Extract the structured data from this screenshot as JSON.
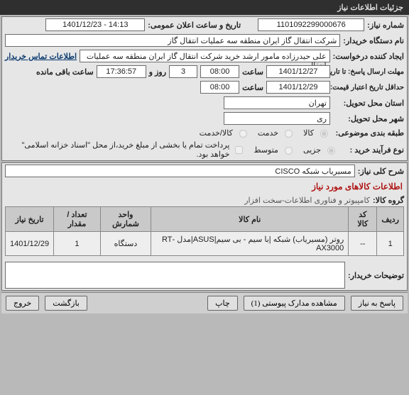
{
  "window_title": "جزئیات اطلاعات نیاز",
  "fields": {
    "need_no_label": "شماره نیاز:",
    "need_no_value": "1101092299000676",
    "announce_label": "تاریخ و ساعت اعلان عمومی:",
    "announce_value": "1401/12/23 - 14:13",
    "org_label": "نام دستگاه خریدار:",
    "org_value": "شرکت انتقال گاز ایران منطقه سه عملیات انتقال گاز",
    "creator_label": "ایجاد کننده درخواست:",
    "creator_value": "علی حیدرزاده مامور ارشد خرید شرکت انتقال گاز ایران منطقه سه عملیات انتقال",
    "contact_link": "اطلاعات تماس خریدار",
    "reply_deadline_label": "مهلت ارسال پاسخ: تا تاریخ:",
    "reply_date": "1401/12/27",
    "time_label": "ساعت",
    "reply_time": "08:00",
    "day_val": "3",
    "day_label": "روز و",
    "remaining_time": "17:36:57",
    "remaining_label": "ساعت باقی مانده",
    "price_valid_label": "حداقل تاریخ اعتبار قیمت: تا تاریخ:",
    "price_date": "1401/12/29",
    "price_time": "08:00",
    "province_label": "استان محل تحویل:",
    "province_value": "تهران",
    "city_label": "شهر محل تحویل:",
    "city_value": "ری",
    "category_label": "طبقه بندی موضوعی:",
    "cat_goods": "کالا",
    "cat_service": "خدمت",
    "cat_both": "کالا/خدمت",
    "buy_type_label": "نوع فرآیند خرید :",
    "bt_low": "جزیی",
    "bt_mid": "متوسط",
    "checkbox_note": "پرداخت تمام یا بخشی از مبلغ خرید،از محل \"اسناد خزانه اسلامی\" خواهد بود.",
    "desc_label": "شرح کلی نیاز:",
    "desc_value": "مسیریاب شبکه CISCO",
    "items_title": "اطلاعات کالاهای مورد نیاز",
    "group_label": "گروه کالا:",
    "group_value": "کامپیوتر و فناوری اطلاعات-سخت افزار",
    "buyer_note_label": "توضیحات خریدار:"
  },
  "table": {
    "headers": [
      "ردیف",
      "کد کالا",
      "نام کالا",
      "واحد شمارش",
      "تعداد / مقدار",
      "تاریخ نیاز"
    ],
    "rows": [
      {
        "idx": "1",
        "code": "--",
        "name": "روتر (مسیریاب) شبکه |با سیم - بی سیم|ASUS|مدل -RT AX3000",
        "unit": "دستگاه",
        "qty": "1",
        "date": "1401/12/29"
      }
    ]
  },
  "buttons": {
    "reply": "پاسخ به نیاز",
    "docs": "مشاهده مدارک پیوستی (1)",
    "print": "چاپ",
    "back": "بازگشت",
    "exit": "خروج"
  }
}
